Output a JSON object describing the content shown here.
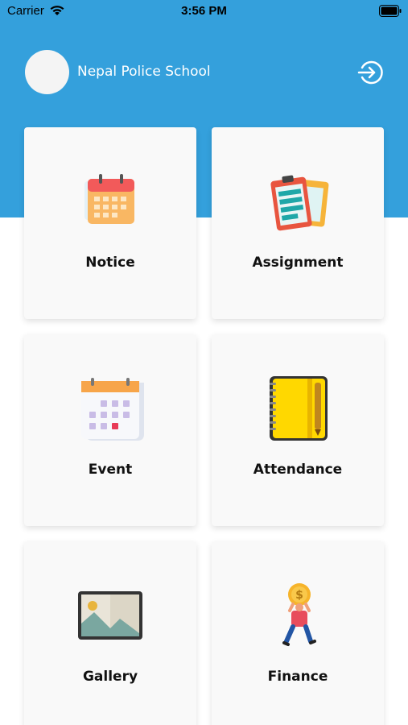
{
  "status_bar": {
    "carrier": "Carrier",
    "time": "3:56 PM"
  },
  "header": {
    "title": "Nepal Police School"
  },
  "colors": {
    "primary": "#34a0dc",
    "card_bg": "#f9f9f9"
  },
  "menu": [
    {
      "label": "Notice",
      "icon": "calendar-icon"
    },
    {
      "label": "Assignment",
      "icon": "clipboard-icon"
    },
    {
      "label": "Event",
      "icon": "event-calendar-icon"
    },
    {
      "label": "Attendance",
      "icon": "notebook-icon"
    },
    {
      "label": "Gallery",
      "icon": "image-icon"
    },
    {
      "label": "Finance",
      "icon": "finance-icon"
    }
  ]
}
